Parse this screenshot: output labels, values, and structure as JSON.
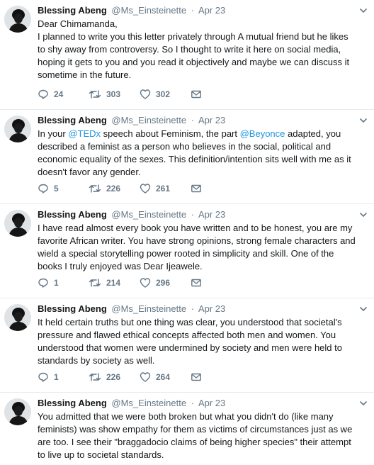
{
  "tweets": [
    {
      "author": "Blessing Abeng",
      "handle": "@Ms_Einsteinette",
      "separator": "·",
      "date": "Apr 23",
      "text_parts": [
        "Dear Chimamanda,\nI planned to write you this letter privately through A mutual friend but he likes to shy away from controversy. So I thought to write it here on social media, hoping it gets to you and you read it objectively and maybe we can discuss it sometime in the future."
      ],
      "replies": "24",
      "retweets": "303",
      "likes": "302"
    },
    {
      "author": "Blessing Abeng",
      "handle": "@Ms_Einsteinette",
      "separator": "·",
      "date": "Apr 23",
      "text_parts": [
        "In your ",
        "@TEDx",
        " speech about Feminism, the part ",
        "@Beyonce",
        " adapted, you described a feminist as a person who believes in the social, political and economic equality of the sexes. This definition/intention sits well with me as it doesn't favor any gender."
      ],
      "replies": "5",
      "retweets": "226",
      "likes": "261"
    },
    {
      "author": "Blessing Abeng",
      "handle": "@Ms_Einsteinette",
      "separator": "·",
      "date": "Apr 23",
      "text_parts": [
        "I have read almost every book you have written and to be honest, you are my favorite African writer. You have strong opinions, strong female characters and wield a special storytelling power rooted in simplicity and skill. One of the books I truly enjoyed was Dear Ijeawele."
      ],
      "replies": "1",
      "retweets": "214",
      "likes": "296"
    },
    {
      "author": "Blessing Abeng",
      "handle": "@Ms_Einsteinette",
      "separator": "·",
      "date": "Apr 23",
      "text_parts": [
        "It held certain truths but one thing was clear, you understood that societal's pressure and flawed ethical concepts affected both men and women. You understood that women were undermined by society and men were held to standards by society as well."
      ],
      "replies": "1",
      "retweets": "226",
      "likes": "264"
    },
    {
      "author": "Blessing Abeng",
      "handle": "@Ms_Einsteinette",
      "separator": "·",
      "date": "Apr 23",
      "text_parts": [
        "You admitted that we were both broken but what you didn't do (like many feminists) was show empathy for them as victims of circumstances just as we are too. I see their \"braggadocio claims of being higher species\" their attempt to live up to societal standards."
      ],
      "replies": "",
      "retweets": "",
      "likes": ""
    }
  ],
  "colors": {
    "name": "#14171a",
    "meta": "#657786",
    "link": "#1b95e0",
    "divider": "#e6ecf0"
  },
  "icons": {
    "reply": "reply-icon",
    "retweet": "retweet-icon",
    "like": "heart-icon",
    "dm": "envelope-icon",
    "menu": "chevron-down-icon"
  }
}
